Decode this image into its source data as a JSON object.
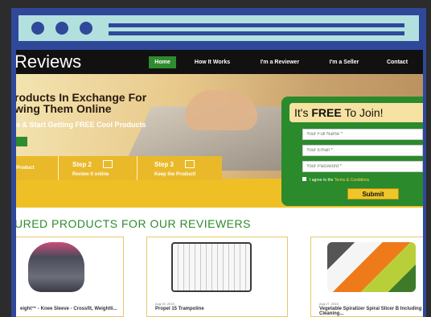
{
  "site": {
    "brand": "Reviews"
  },
  "nav": {
    "items": [
      {
        "label": "Home",
        "active": true
      },
      {
        "label": "How It Works"
      },
      {
        "label": "I'm a Reviewer"
      },
      {
        "label": "I'm a Seller"
      },
      {
        "label": "Contact"
      }
    ]
  },
  "hero": {
    "headline_1": "roducts In Exchange For",
    "headline_2": "wing Them Online",
    "subline": "w & Start Getting FREE Cool Products"
  },
  "steps": [
    {
      "title": "",
      "subtitle": "Product"
    },
    {
      "title": "Step 2",
      "subtitle": "Review it online"
    },
    {
      "title": "Step 3",
      "subtitle": "Keep the Product!"
    }
  ],
  "join": {
    "title_pre": "It's ",
    "title_bold": "FREE",
    "title_post": " To Join!",
    "name_placeholder": "Your Full Name *",
    "email_placeholder": "Your Email *",
    "password_placeholder": "Your Password *",
    "agree_text": "I agree to the ",
    "terms_link": "Terms & Conditions",
    "submit_label": "Submit"
  },
  "featured": {
    "heading": "URED PRODUCTS FOR OUR REVIEWERS",
    "cards": [
      {
        "date": "",
        "title": "eight™ - Knee Sleeve - Crossfit, Weightli..."
      },
      {
        "date": "Aug 19, 2015",
        "title": "Propel 15 Trampoline"
      },
      {
        "date": "Aug 27, 2015",
        "title": "Vegetable Spiralizer Spiral Slicer B Including Cleaning..."
      }
    ]
  },
  "colors": {
    "frame": "#30489a",
    "titlebar": "#b1e0df",
    "green": "#2e8b2e",
    "yellow": "#efc025"
  }
}
